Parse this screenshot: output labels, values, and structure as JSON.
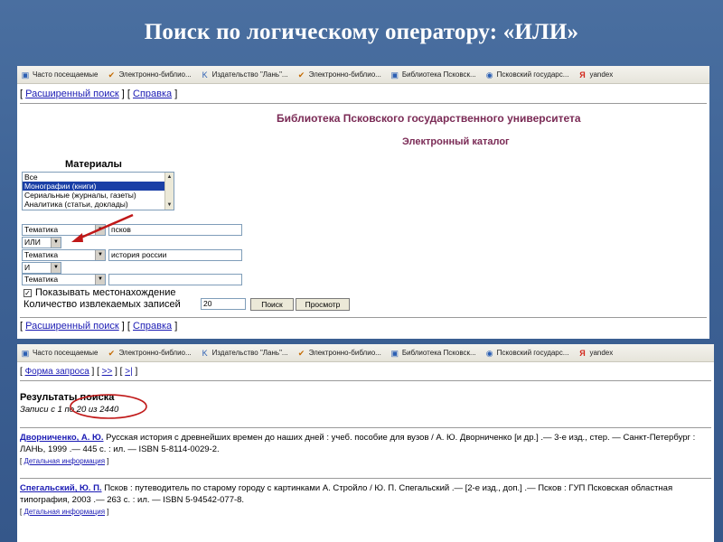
{
  "slide": {
    "title": "Поиск по логическому оператору: «ИЛИ»"
  },
  "bookmarks": [
    {
      "label": "Часто посещаемые",
      "icon": "page-icon"
    },
    {
      "label": "Электронно-библио...",
      "icon": "check-icon"
    },
    {
      "label": "Издательство \"Лань\"...",
      "icon": "k-icon"
    },
    {
      "label": "Электронно-библио...",
      "icon": "check-icon"
    },
    {
      "label": "Библиотека Псковск...",
      "icon": "page-icon"
    },
    {
      "label": "Псковский государс...",
      "icon": "globe-icon"
    },
    {
      "label": "yandex",
      "icon": "yandex-icon"
    }
  ],
  "search_form": {
    "top_links": {
      "advanced": "Расширенный поиск",
      "help": "Справка"
    },
    "library_title": "Библиотека Псковского государственного университета",
    "catalog_title": "Электронный каталог",
    "materials_label": "Материалы",
    "materials_options": [
      "Все",
      "Монографии (книги)",
      "Сериальные (журналы, газеты)",
      "Аналитика (статьи, доклады)"
    ],
    "selected_material_index": 1,
    "rows": [
      {
        "field": "Тематика",
        "value": "псков"
      },
      {
        "operator": "ИЛИ"
      },
      {
        "field": "Тематика",
        "value": "история россии"
      },
      {
        "operator": "И"
      },
      {
        "field": "Тематика",
        "value": ""
      }
    ],
    "show_location_label": "Показывать местонахождение",
    "show_location_checked": true,
    "records_count_label": "Количество извлекаемых записей",
    "records_count_value": "20",
    "search_button": "Поиск",
    "browse_button": "Просмотр",
    "bottom_links": {
      "advanced": "Расширенный поиск",
      "help": "Справка"
    }
  },
  "results": {
    "nav": {
      "form": "Форма запроса",
      "next": ">>",
      "last": ">|"
    },
    "title": "Результаты поиска",
    "subtitle": "Записи с 1 по 20 из 2440",
    "records": [
      {
        "author": "Дворниченко, А. Ю.",
        "text": "Русская история с древнейших времен до наших дней : учеб. пособие для вузов / А. Ю. Дворниченко [и др.] .— 3-е изд., стер. — Санкт-Петербург : ЛАНЬ, 1999 .— 445 с. : ил. — ISBN 5-8114-0029-2.",
        "detail": "Детальная информация"
      },
      {
        "author": "Спегальский, Ю. П.",
        "text": "Псков : путеводитель по старому городу с картинками А. Стройло / Ю. П. Спегальский .— [2-е изд., доп.] .— Псков : ГУП Псковская областная типография, 2003 .— 263 с. : ил. — ISBN 5-94542-077-8.",
        "detail": "Детальная информация"
      }
    ]
  },
  "colors": {
    "background": "#3e6396",
    "heading": "#7a2a55",
    "link": "#1b1bb4",
    "annotation": "#c01818"
  }
}
